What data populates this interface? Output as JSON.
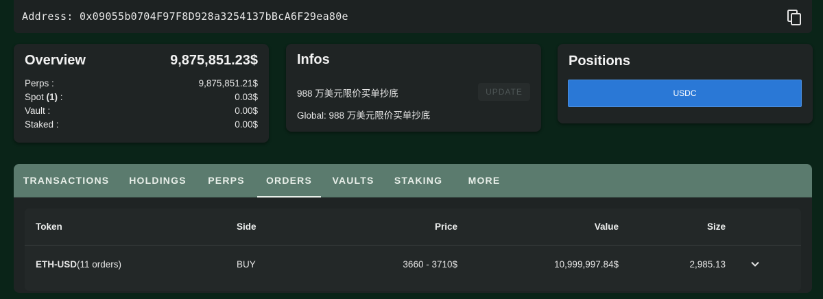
{
  "address": {
    "label": "Address:",
    "value": "0x09055b0704F97F8D928a3254137bBcA6F29ea80e"
  },
  "overview": {
    "title": "Overview",
    "total": "9,875,851.23$",
    "rows": [
      {
        "label": "Perps :",
        "value": "9,875,851.21$"
      },
      {
        "label_prefix": "Spot ",
        "label_count": "(1)",
        "label_suffix": " :",
        "value": "0.03$"
      },
      {
        "label": "Vault :",
        "value": "0.00$"
      },
      {
        "label": "Staked :",
        "value": "0.00$"
      }
    ]
  },
  "infos": {
    "title": "Infos",
    "line1": "988 万美元限价买单抄底",
    "update_label": "UPDATE",
    "line2": "Global: 988 万美元限价买单抄底"
  },
  "positions": {
    "title": "Positions",
    "button_label": "USDC"
  },
  "tabs": [
    {
      "label": "TRANSACTIONS",
      "active": false
    },
    {
      "label": "HOLDINGS",
      "active": false
    },
    {
      "label": "PERPS",
      "active": false
    },
    {
      "label": "ORDERS",
      "active": true
    },
    {
      "label": "VAULTS",
      "active": false
    },
    {
      "label": "STAKING",
      "active": false
    },
    {
      "label": "MORE",
      "active": false
    }
  ],
  "table": {
    "headers": {
      "token": "Token",
      "side": "Side",
      "price": "Price",
      "value": "Value",
      "size": "Size"
    },
    "rows": [
      {
        "token": "ETH-USD",
        "orders": "(11 orders)",
        "side": "BUY",
        "price": "3660 - 3710$",
        "value": "10,999,997.84$",
        "size": "2,985.13"
      }
    ]
  },
  "icons": {
    "copy": "copy-icon",
    "expand": "chevron-down-icon"
  },
  "colors": {
    "background": "#0a2418",
    "card": "#1f2424",
    "tabs_bar": "#5b7b6e",
    "accent_blue": "#2a78d6",
    "buy_green": "#1f9d3a"
  }
}
